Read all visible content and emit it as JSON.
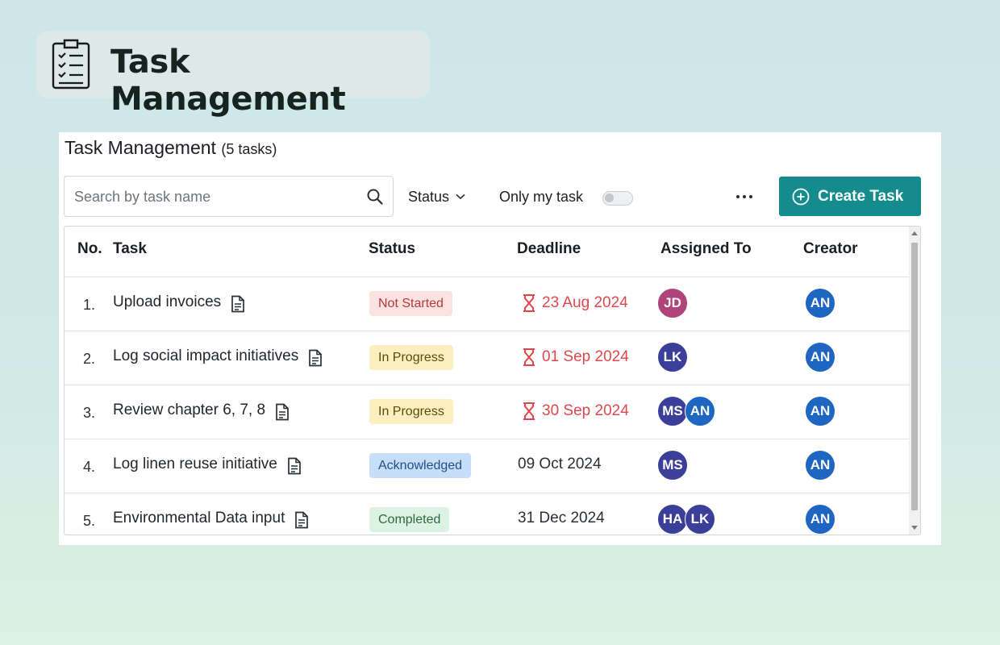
{
  "hero": {
    "title": "Task Management",
    "icon": "clipboard-checklist-icon"
  },
  "panel": {
    "title": "Task Management",
    "count": "(5 tasks)"
  },
  "toolbar": {
    "search_placeholder": "Search by task name",
    "status_filter": "Status",
    "only_my_task": "Only my task",
    "only_my_task_on": false,
    "create_label": "Create Task"
  },
  "table": {
    "headers": {
      "no": "No.",
      "task": "Task",
      "status": "Status",
      "deadline": "Deadline",
      "assigned": "Assigned To",
      "creator": "Creator"
    },
    "rows": [
      {
        "no": "1.",
        "task": "Upload invoices",
        "status": "Not Started",
        "deadline": "23 Aug 2024",
        "overdue": true,
        "assigned": [
          "JD"
        ],
        "creator": "AN"
      },
      {
        "no": "2.",
        "task": "Log social impact initiatives",
        "status": "In Progress",
        "deadline": "01 Sep 2024",
        "overdue": true,
        "assigned": [
          "LK"
        ],
        "creator": "AN"
      },
      {
        "no": "3.",
        "task": "Review chapter 6, 7, 8",
        "status": "In Progress",
        "deadline": "30 Sep 2024",
        "overdue": true,
        "assigned": [
          "MS",
          "AN"
        ],
        "creator": "AN"
      },
      {
        "no": "4.",
        "task": "Log linen reuse initiative",
        "status": "Acknowledged",
        "deadline": "09 Oct 2024",
        "overdue": false,
        "assigned": [
          "MS"
        ],
        "creator": "AN"
      },
      {
        "no": "5.",
        "task": "Environmental Data input",
        "status": "Completed",
        "deadline": "31 Dec 2024",
        "overdue": false,
        "assigned": [
          "HA",
          "LK"
        ],
        "creator": "AN"
      }
    ]
  },
  "colors": {
    "accent": "#148c8e",
    "overdue": "#e0474c",
    "status": {
      "Not Started": {
        "bg": "#fde2e2",
        "fg": "#b23a3a"
      },
      "In Progress": {
        "bg": "#fbefc0",
        "fg": "#5f4a0c"
      },
      "Acknowledged": {
        "bg": "#c7def8",
        "fg": "#1f4f86"
      },
      "Completed": {
        "bg": "#dcf3e3",
        "fg": "#2f6a41"
      }
    },
    "avatars": {
      "JD": "#b0437a",
      "LK": "#3b3f9a",
      "MS": "#3b3f9a",
      "AN": "#1f66c2",
      "HA": "#3b3f9a"
    }
  }
}
